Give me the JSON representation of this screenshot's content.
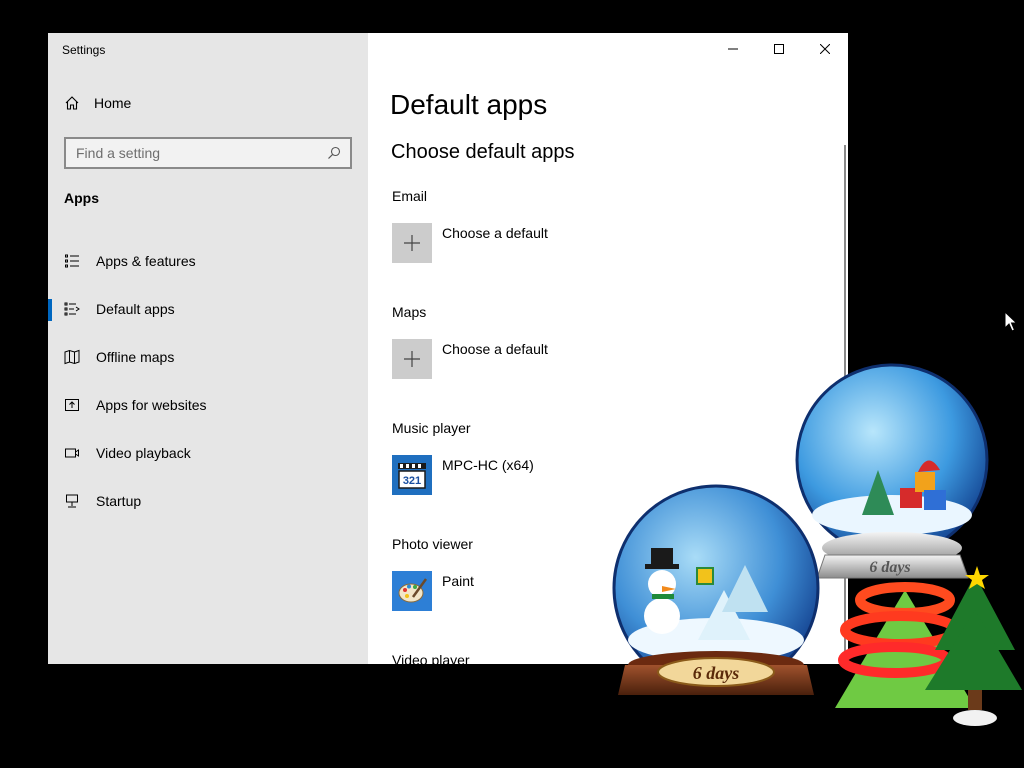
{
  "window": {
    "title": "Settings"
  },
  "sidebar": {
    "home_label": "Home",
    "search": {
      "placeholder": "Find a setting"
    },
    "section_label": "Apps",
    "items": [
      {
        "label": "Apps & features",
        "icon": "list-icon"
      },
      {
        "label": "Default apps",
        "icon": "default-apps-icon",
        "active": true
      },
      {
        "label": "Offline maps",
        "icon": "map-icon"
      },
      {
        "label": "Apps for websites",
        "icon": "open-external-icon"
      },
      {
        "label": "Video playback",
        "icon": "video-icon"
      },
      {
        "label": "Startup",
        "icon": "startup-icon"
      }
    ]
  },
  "main": {
    "page_title": "Default apps",
    "sub_title": "Choose default apps",
    "categories": [
      {
        "label": "Email",
        "app": "Choose a default",
        "icon": "plus-icon"
      },
      {
        "label": "Maps",
        "app": "Choose a default",
        "icon": "plus-icon"
      },
      {
        "label": "Music player",
        "app": "MPC-HC (x64)",
        "icon": "mpc-hc-icon"
      },
      {
        "label": "Photo viewer",
        "app": "Paint",
        "icon": "paint-icon"
      },
      {
        "label": "Video player"
      }
    ]
  },
  "desktop": {
    "snow_globe_left_label": "6 days",
    "snow_globe_right_label": "6 days"
  },
  "colors": {
    "accent": "#0067c0",
    "sidebar_bg": "#e6e6e6",
    "desktop_bg": "#000000"
  }
}
